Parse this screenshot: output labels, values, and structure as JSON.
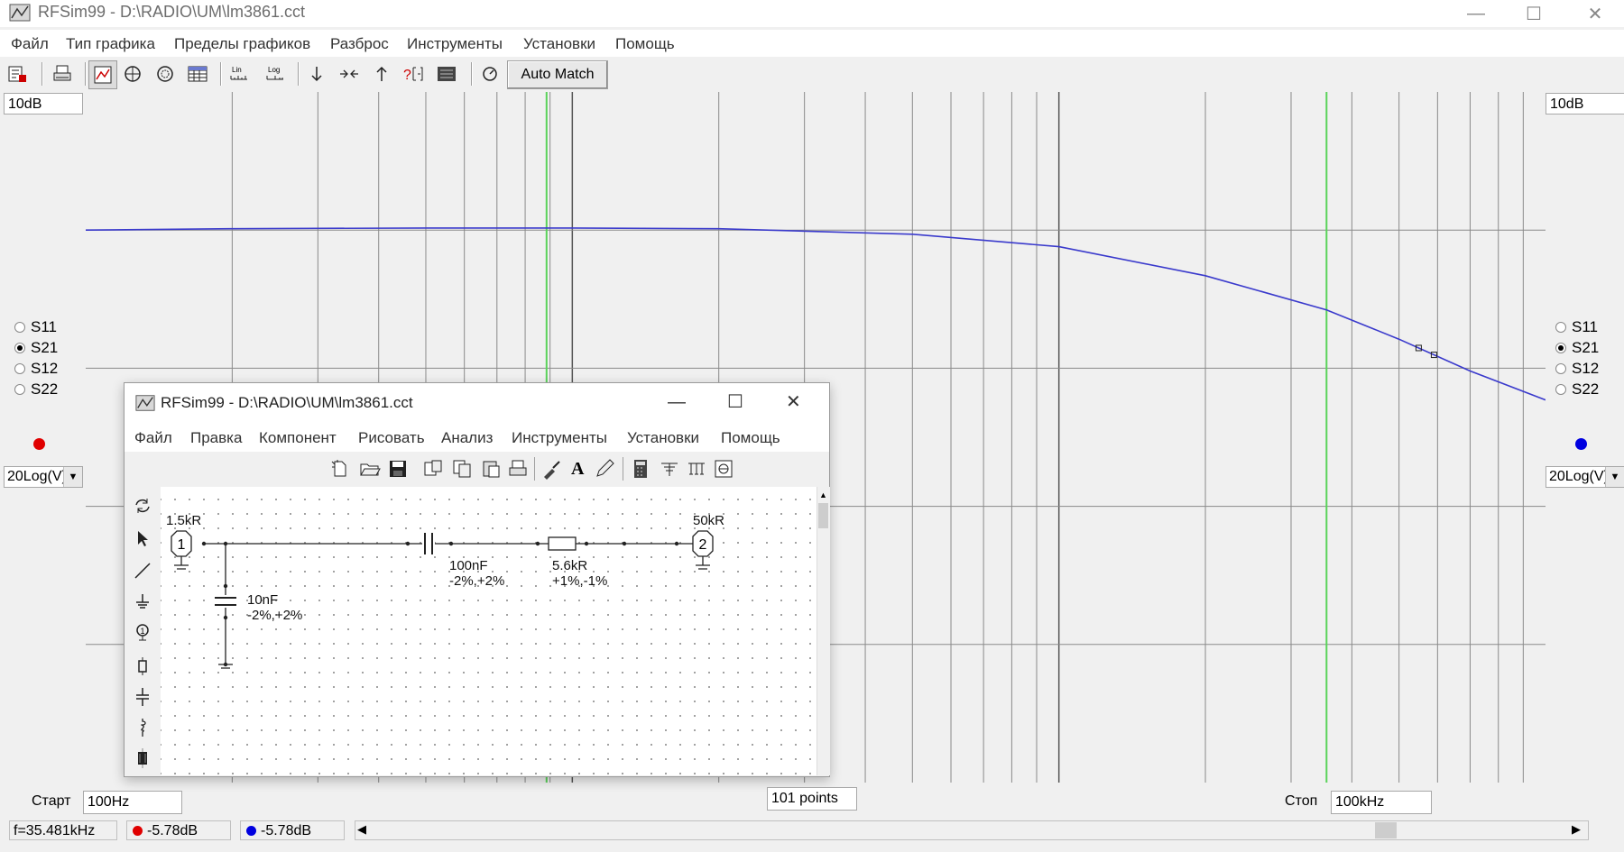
{
  "window": {
    "title": "RFSim99 - D:\\RADIO\\UM\\lm3861.cct"
  },
  "menu": [
    "Файл",
    "Тип графика",
    "Пределы графиков",
    "Разброс",
    "Инструменты",
    "Установки",
    "Помощь"
  ],
  "toolbar": {
    "auto_match_label": "Auto Match",
    "lin_label": "Lin",
    "log_label": "Log"
  },
  "left_panel": {
    "scale": "10dB",
    "params": [
      "S11",
      "S21",
      "S12",
      "S22"
    ],
    "selected": "S21",
    "marker_color": "#e00000",
    "format": "20Log(V)"
  },
  "right_panel": {
    "scale": "10dB",
    "params": [
      "S11",
      "S21",
      "S12",
      "S22"
    ],
    "selected": "S21",
    "marker_color": "#0000e0",
    "format": "20Log(V)"
  },
  "chart_data": {
    "type": "line",
    "x_scale": "log",
    "xlim": [
      100,
      100000
    ],
    "ylim": [
      -40,
      10
    ],
    "grid": true,
    "marker_frequency": 35481,
    "series": [
      {
        "color": "#3a3acc",
        "x": [
          100,
          200,
          500,
          1000,
          2000,
          5000,
          10000,
          20000,
          35481,
          50000,
          70000,
          100000
        ],
        "values": [
          0,
          0.1,
          0.15,
          0.15,
          0.1,
          -0.3,
          -1.2,
          -3.3,
          -5.78,
          -7.9,
          -10.2,
          -12.3
        ]
      }
    ]
  },
  "bottom": {
    "start_label": "Старт",
    "start_value": "100Hz",
    "points_value": "101 points",
    "stop_label": "Стоп",
    "stop_value": "100kHz"
  },
  "status": {
    "freq": "f=35.481kHz",
    "left_value": "-5.78dB",
    "right_value": "-5.78dB"
  },
  "schematic_window": {
    "title": "RFSim99 - D:\\RADIO\\UM\\lm3861.cct",
    "menu": [
      "Файл",
      "Правка",
      "Компонент",
      "Рисовать",
      "Анализ",
      "Инструменты",
      "Установки",
      "Помощь"
    ],
    "port1": {
      "number": "1",
      "impedance": "1.5kR"
    },
    "port2": {
      "number": "2",
      "impedance": "50kR"
    },
    "c_series": {
      "value": "100nF",
      "tolerance": "-2%,+2%"
    },
    "r_series": {
      "value": "5.6kR",
      "tolerance": "+1%,-1%"
    },
    "c_shunt": {
      "value": "10nF",
      "tolerance": "-2%,+2%"
    },
    "text_tool": "A"
  }
}
